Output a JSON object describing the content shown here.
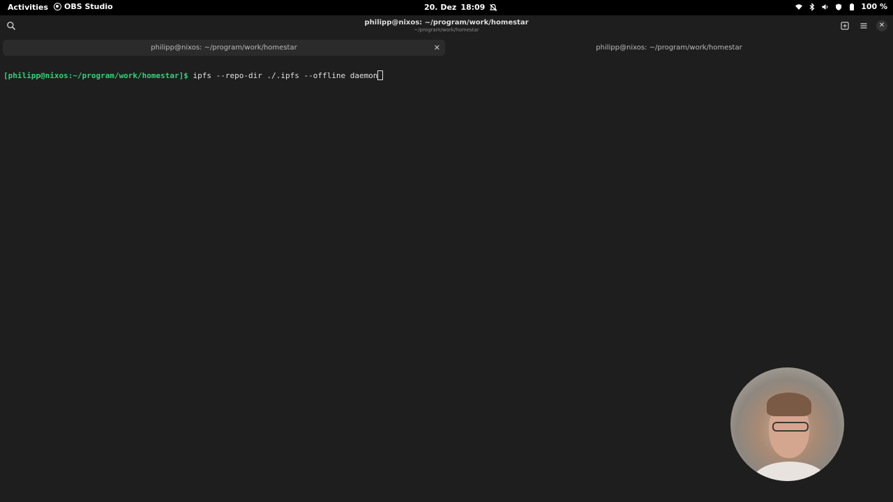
{
  "topbar": {
    "activities_label": "Activities",
    "app_name": "OBS Studio",
    "date": "20. Dez",
    "time": "18:09",
    "battery": "100 %",
    "tray_icons": [
      "wifi-icon",
      "bluetooth-icon",
      "volume-icon",
      "security-icon",
      "battery-icon"
    ]
  },
  "window": {
    "title": "philipp@nixos: ~/program/work/homestar",
    "subtitle": "~/program/work/homestar"
  },
  "tabs": [
    {
      "label": "philipp@nixos: ~/program/work/homestar",
      "active": true
    },
    {
      "label": "philipp@nixos: ~/program/work/homestar",
      "active": false
    }
  ],
  "terminal": {
    "prompt": "[philipp@nixos:~/program/work/homestar]$",
    "command": " ipfs --repo-dir ./.ipfs --offline daemon"
  },
  "colors": {
    "prompt_green": "#33d17a",
    "terminal_bg": "#1e1e1e",
    "topbar_bg": "#000000"
  }
}
